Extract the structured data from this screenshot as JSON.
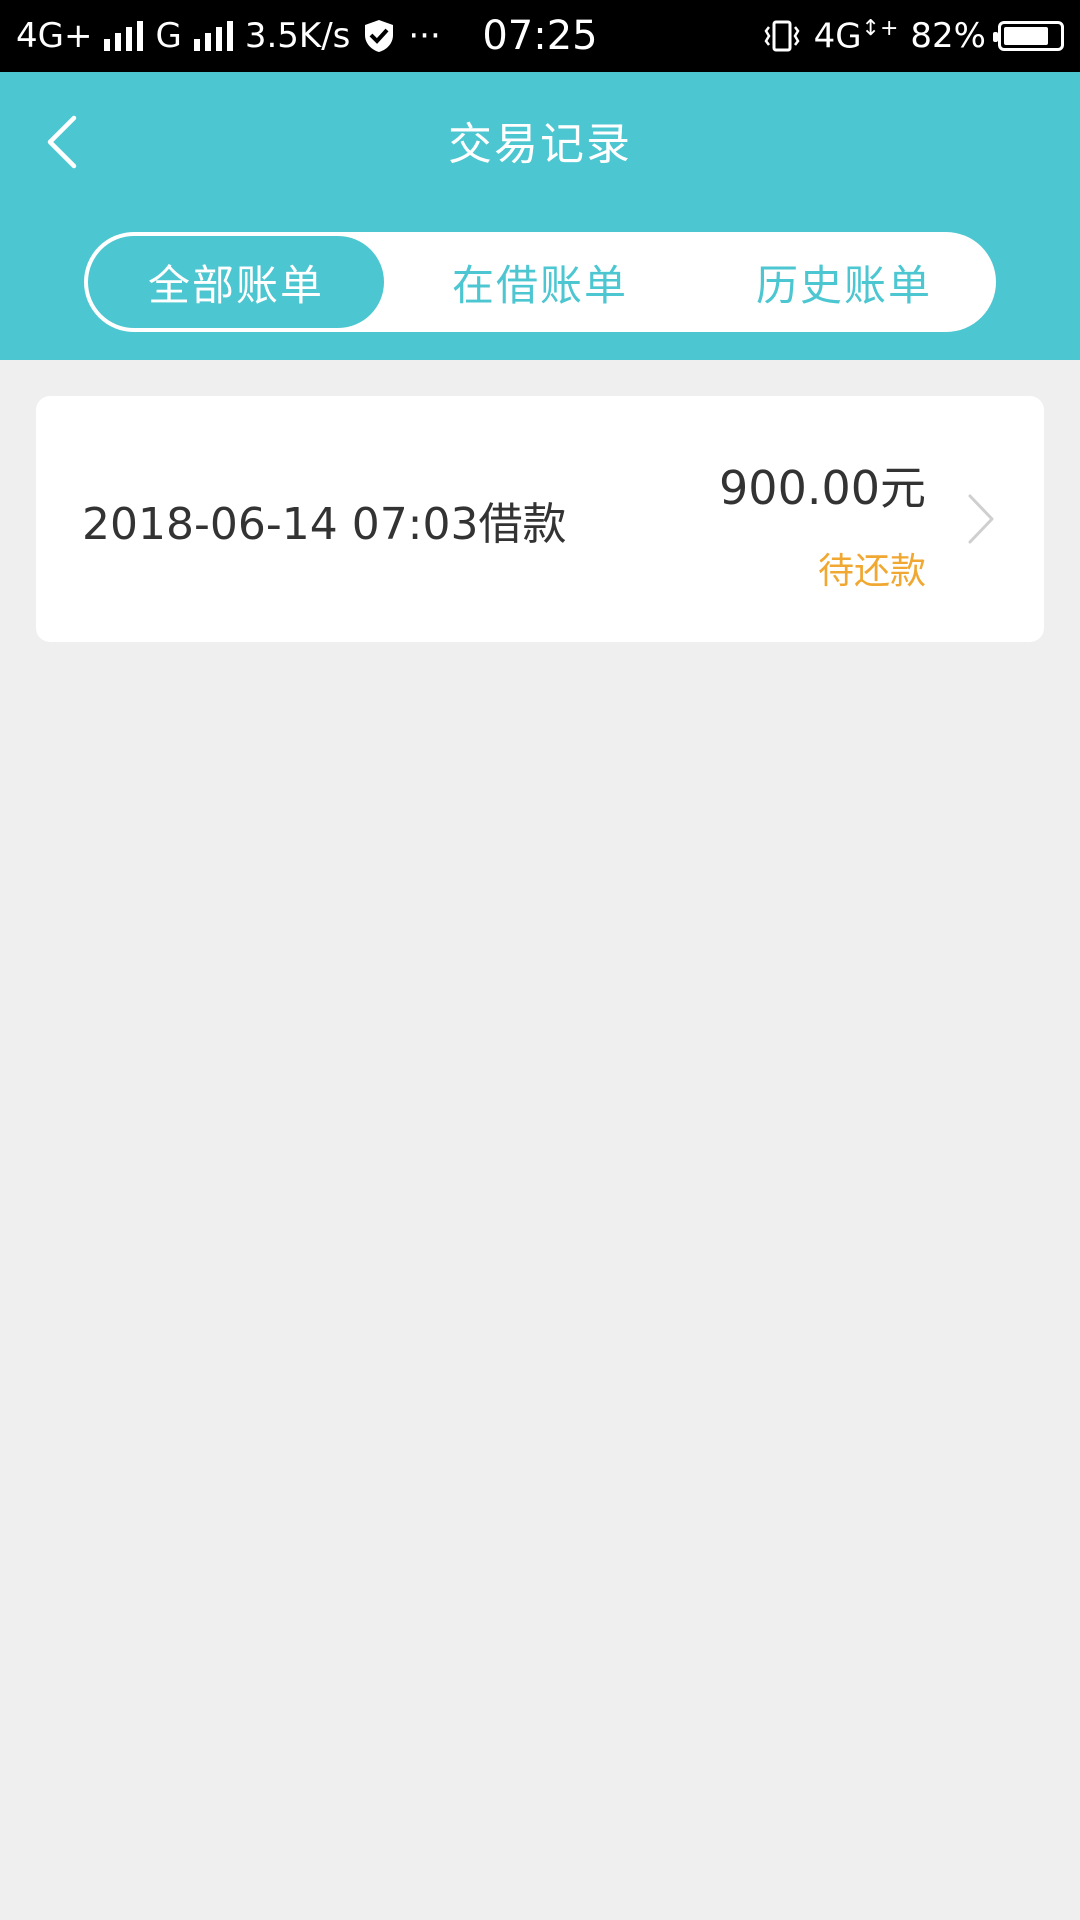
{
  "status_bar": {
    "network1": "4G+",
    "network2": "G",
    "speed": "3.5K/s",
    "more": "···",
    "time": "07:25",
    "network3": "4G",
    "battery_text": "82%",
    "battery_level": 0.82
  },
  "header": {
    "title": "交易记录",
    "back_icon": "back-arrow-icon",
    "tabs": [
      {
        "label": "全部账单",
        "active": true
      },
      {
        "label": "在借账单",
        "active": false
      },
      {
        "label": "历史账单",
        "active": false
      }
    ]
  },
  "records": [
    {
      "date": "2018-06-14  07:03借款",
      "amount": "900.00元",
      "status": "待还款"
    }
  ],
  "colors": {
    "accent": "#4cc6d0",
    "status_pending": "#f0a832",
    "background": "#efefef"
  }
}
